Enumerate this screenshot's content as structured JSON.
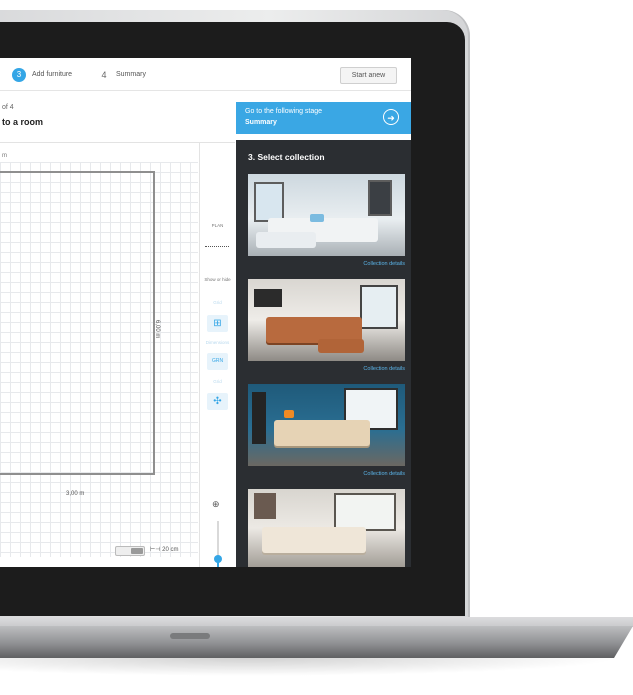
{
  "steps": [
    {
      "num": "3",
      "label": "Add furniture",
      "active": true
    },
    {
      "num": "4",
      "label": "Summary",
      "active": false
    }
  ],
  "start_anew": "Start anew",
  "step_counter": "of 4",
  "page_heading": "to a room",
  "dim_top_mark": "m",
  "dimensions": {
    "right": "6,00 m",
    "bottom": "3,00 m"
  },
  "scale": {
    "label": "20 cm"
  },
  "tools": {
    "plan_label": "PLAN",
    "show_hide_label": "Show or hide",
    "items": [
      "Grid",
      "Dimensions",
      "Grid",
      "Furniture"
    ],
    "box_label": "GRN"
  },
  "next_stage": {
    "line1": "Go to the following stage",
    "line2": "Summary",
    "icon": "arrow-right-icon"
  },
  "panel": {
    "title": "3. Select collection",
    "collections": [
      {
        "details": "Collection details"
      },
      {
        "details": "Collection details"
      },
      {
        "details": "Collection details"
      }
    ]
  },
  "colors": {
    "accent": "#3aa7e4",
    "panel": "#2b2e32"
  }
}
